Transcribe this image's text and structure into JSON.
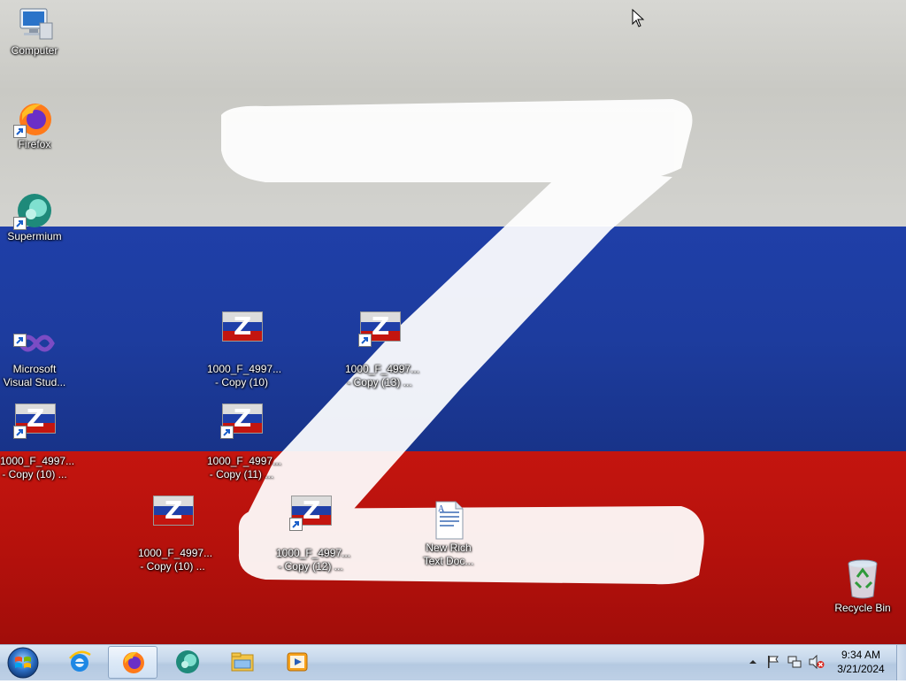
{
  "desktop": {
    "icons": [
      {
        "label": "Computer",
        "icon": "computer-icon"
      },
      {
        "label": "Firefox",
        "icon": "firefox-icon"
      },
      {
        "label": "Supermium",
        "icon": "supermium-icon"
      },
      {
        "label": "Microsoft\nVisual Stud...",
        "icon": "visual-studio-icon"
      },
      {
        "label": "1000_F_4997...\n- Copy (10) ...",
        "icon": "image-file-icon"
      },
      {
        "label": "1000_F_4997...\n- Copy (10)",
        "icon": "image-file-icon"
      },
      {
        "label": "1000_F_4997...\n- Copy (11) ...",
        "icon": "image-file-icon"
      },
      {
        "label": "1000_F_4997...\n- Copy (13) ...",
        "icon": "image-file-icon"
      },
      {
        "label": "1000_F_4997...\n- Copy (10) ...",
        "icon": "image-file-icon"
      },
      {
        "label": "1000_F_4997...\n- Copy (12) ...",
        "icon": "image-file-icon"
      },
      {
        "label": "New Rich\nText Doc...",
        "icon": "rich-text-document-icon"
      },
      {
        "label": "Recycle Bin",
        "icon": "recycle-bin-icon"
      }
    ],
    "wallpaper": {
      "colors": {
        "white": "#d7d7d3",
        "blue": "#1f3fa8",
        "red": "#c4150f"
      }
    }
  },
  "taskbar": {
    "start_icon": "windows-start-icon",
    "pinned": [
      {
        "name": "internet-explorer-icon",
        "active": false
      },
      {
        "name": "firefox-icon",
        "active": true
      },
      {
        "name": "supermium-icon",
        "active": false
      },
      {
        "name": "file-explorer-icon",
        "active": false
      },
      {
        "name": "media-player-icon",
        "active": false
      }
    ],
    "tray": {
      "icons": [
        "show-hidden-icons-arrow",
        "action-center-flag-icon",
        "network-icon",
        "volume-muted-icon"
      ],
      "time": "9:34 AM",
      "date": "3/21/2024"
    }
  }
}
